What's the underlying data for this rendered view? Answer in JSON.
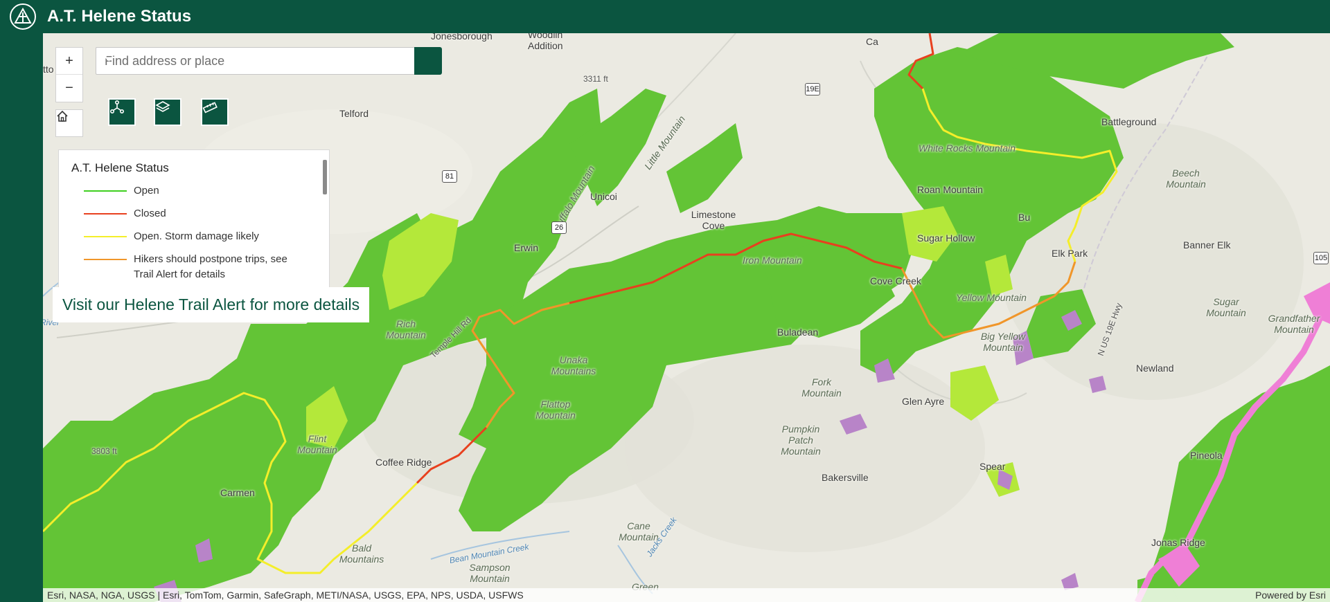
{
  "header": {
    "title": "A.T. Helene Status",
    "logo_icon": "appalachian-trail-logo"
  },
  "search": {
    "placeholder": "Find address or place",
    "value": ""
  },
  "map_controls": {
    "zoom_in": "+",
    "zoom_out": "−",
    "home_icon": "home-icon",
    "tools": [
      "share-icon",
      "layers-icon",
      "measure-icon"
    ]
  },
  "legend": {
    "title": "A.T. Helene Status",
    "items": [
      {
        "label": "Open",
        "color": "#3ecf1f"
      },
      {
        "label": "Closed",
        "color": "#e8401e"
      },
      {
        "label": "Open. Storm damage likely",
        "color": "#f4ee2a"
      },
      {
        "label": "Hikers should postpone trips, see Trail Alert for details",
        "color": "#f0962a"
      }
    ]
  },
  "alert_link": {
    "label": "Visit our Helene Trail Alert for more details"
  },
  "colors": {
    "brand": "#0b5540",
    "forest": "#63c436",
    "forest_light": "#b4e83a",
    "wilderness": "#b884c8",
    "pink_boundary": "#ef7fd6",
    "basemap": "#ebeae2"
  },
  "map": {
    "labels": [
      "Jonesborough",
      "Woodlin Addition",
      "Telford",
      "Unicoi",
      "Limestone Cove",
      "Erwin",
      "Battleground",
      "Roan Mountain",
      "Sugar Hollow",
      "Elk Park",
      "Beech Mountain",
      "Banner Elk",
      "Cove Creek",
      "Buladean",
      "Newland",
      "Glen Ayre",
      "Spear",
      "Pineola",
      "Bakersville",
      "Coffee Ridge",
      "Carmen",
      "Jonas Ridge",
      "Cane Mountain",
      "Sampson Mountain",
      "Pumpkin Patch Mountain",
      "Flattop Mountain",
      "Unaka Mountains",
      "Rich Mountain",
      "Flint Mountain",
      "Bald Mountains",
      "White Rocks Mountain",
      "Little Mountain",
      "Iron Mountain",
      "Yellow Mountain",
      "Big Yellow Mountain",
      "Sugar Mountain",
      "Grandfather Mountain",
      "Fork Mountain",
      "Buffalo Mountain",
      "Green",
      "Temple Hill Rd",
      "N US 19E Hwy",
      "Bean Mountain Creek",
      "Jacks Creek",
      "River",
      "Bu",
      "Ca",
      "tto",
      "3803 ft",
      "3311 ft"
    ],
    "shields": [
      "19E",
      "81",
      "26",
      "105"
    ]
  },
  "attribution": {
    "sources": "Esri, NASA, NGA, USGS | Esri, TomTom, Garmin, SafeGraph, METI/NASA, USGS, EPA, NPS, USDA, USFWS",
    "powered_by": "Powered by Esri"
  }
}
